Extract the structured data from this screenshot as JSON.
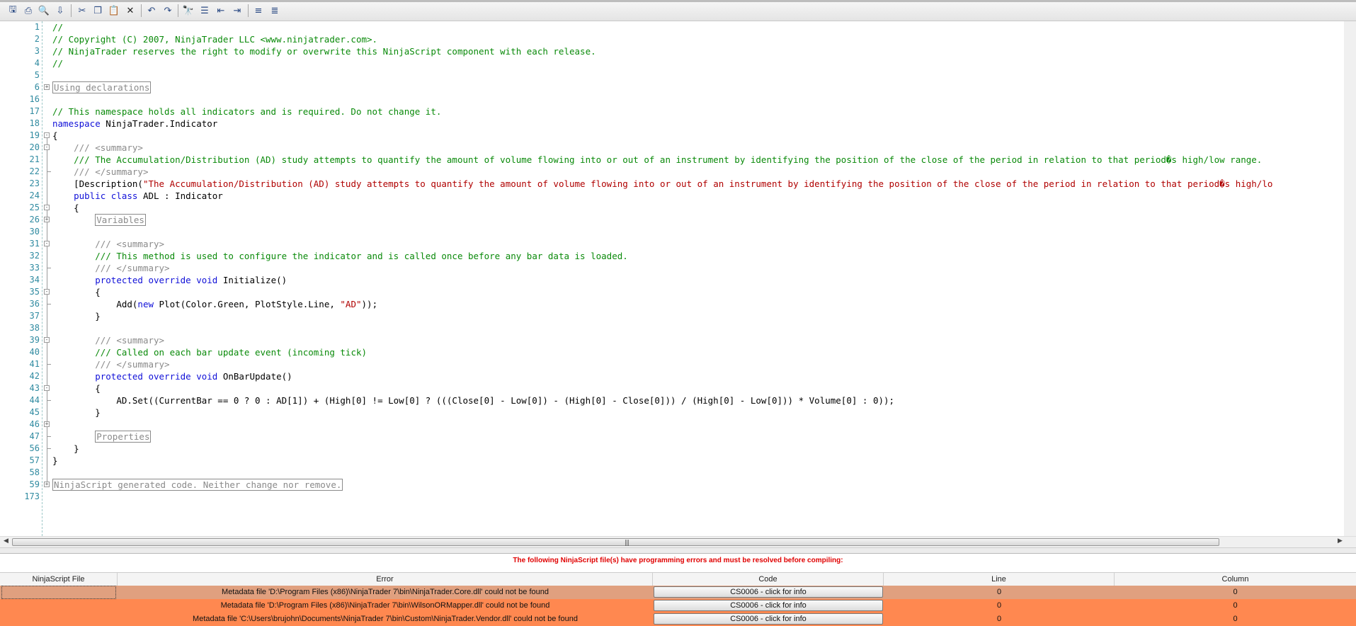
{
  "toolbar": {
    "buttons": [
      "save-icon",
      "print-icon",
      "print-preview-icon",
      "export-icon",
      "cut-icon",
      "copy-icon",
      "paste-icon",
      "delete-icon",
      "undo-icon",
      "redo-icon",
      "find-icon",
      "find-next-icon",
      "outdent-icon",
      "indent-icon",
      "comment-icon",
      "uncomment-icon"
    ]
  },
  "editor": {
    "line_numbers": [
      "1",
      "2",
      "3",
      "4",
      "5",
      "6",
      "16",
      "17",
      "18",
      "19",
      "20",
      "21",
      "22",
      "23",
      "24",
      "25",
      "26",
      "30",
      "31",
      "32",
      "33",
      "34",
      "35",
      "36",
      "37",
      "38",
      "39",
      "40",
      "41",
      "42",
      "43",
      "44",
      "45",
      "46",
      "47",
      "56",
      "57",
      "58",
      "59",
      "173"
    ],
    "lines": {
      "l1": "//",
      "l2": "// Copyright (C) 2007, NinjaTrader LLC <www.ninjatrader.com>.",
      "l3": "// NinjaTrader reserves the right to modify or overwrite this NinjaScript component with each release.",
      "l4": "//",
      "l6": "Using declarations",
      "l17": "// This namespace holds all indicators and is required. Do not change it.",
      "l18_kw": "namespace",
      "l18_rest": " NinjaTrader.Indicator",
      "l19": "{",
      "l20_pre": "/// ",
      "l20_tag": "<summary>",
      "l21": "/// The Accumulation/Distribution (AD) study attempts to quantify the amount of volume flowing into or out of an instrument by identifying the position of the close of the period in relation to that period�s high/low range.",
      "l22_pre": "/// ",
      "l22_tag": "</summary>",
      "l23_pre": "[Description(",
      "l23_str": "\"The Accumulation/Distribution (AD) study attempts to quantify the amount of volume flowing into or out of an instrument by identifying the position of the close of the period in relation to that period�s high/lo",
      "l24_kw": "public class",
      "l24_rest": " ADL : Indicator",
      "l25": "{",
      "l26": "Variables",
      "l31_pre": "/// ",
      "l31_tag": "<summary>",
      "l32": "/// This method is used to configure the indicator and is called once before any bar data is loaded.",
      "l33_pre": "/// ",
      "l33_tag": "</summary>",
      "l34_kw": "protected override void",
      "l34_rest": " Initialize()",
      "l35": "{",
      "l36_a": "Add(",
      "l36_kw": "new",
      "l36_b": " Plot(Color.Green, PlotStyle.Line, ",
      "l36_str": "\"AD\"",
      "l36_c": "));",
      "l37": "}",
      "l39_pre": "/// ",
      "l39_tag": "<summary>",
      "l40": "/// Called on each bar update event (incoming tick)",
      "l41_pre": "/// ",
      "l41_tag": "</summary>",
      "l42_kw": "protected override void",
      "l42_rest": " OnBarUpdate()",
      "l43": "{",
      "l44": "AD.Set((CurrentBar == 0 ? 0 : AD[1]) + (High[0] != Low[0] ? (((Close[0] - Low[0]) - (High[0] - Close[0])) / (High[0] - Low[0])) * Volume[0] : 0));",
      "l45": "}",
      "l47": "Properties",
      "l56": "}",
      "l57": "}",
      "l59": "NinjaScript generated code. Neither change nor remove."
    }
  },
  "errors": {
    "title": "The following NinjaScript file(s) have programming errors and must be resolved before compiling:",
    "columns": [
      "NinjaScript File",
      "Error",
      "Code",
      "Line",
      "Column"
    ],
    "rows": [
      {
        "file": "",
        "error": "Metadata file 'D:\\Program Files (x86)\\NinjaTrader 7\\bin\\NinjaTrader.Core.dll' could not be found",
        "code": "CS0006 - click for info",
        "line": "0",
        "column": "0"
      },
      {
        "file": "",
        "error": "Metadata file 'D:\\Program Files (x86)\\NinjaTrader 7\\bin\\WilsonORMapper.dll' could not be found",
        "code": "CS0006 - click for info",
        "line": "0",
        "column": "0"
      },
      {
        "file": "",
        "error": "Metadata file 'C:\\Users\\brujohn\\Documents\\NinjaTrader 7\\bin\\Custom\\NinjaTrader.Vendor.dll' could not be found",
        "code": "CS0006 - click for info",
        "line": "0",
        "column": "0"
      }
    ]
  },
  "colors": {
    "error_row": "#ff8850",
    "selected_row": "#e0a07f",
    "title_red": "#e00000",
    "comment_green": "#0a8a0a",
    "keyword_blue": "#1010d8",
    "string_red": "#b00000"
  }
}
